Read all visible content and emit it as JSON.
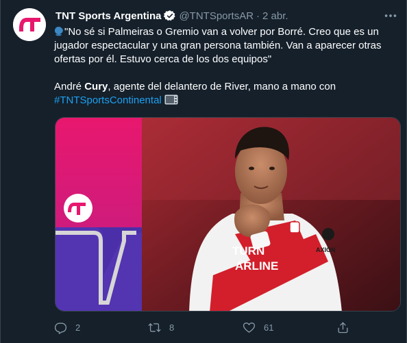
{
  "tweet": {
    "author_name": "TNT Sports Argentina",
    "handle": "@TNTSportsAR",
    "separator": "·",
    "date": "2 abr.",
    "quote_text": "\"No sé si Palmeiras o Gremio van a volver por Borré. Creo que es un jugador espectacular y una gran persona también. Van a aparecer otras ofertas por él. Estuvo cerca de los dos equipos\"",
    "second_paragraph_prefix": "André ",
    "second_paragraph_bold": "Cury",
    "second_paragraph_suffix": ", agente del delantero de River, mano a mano con",
    "hashtag": "#TNTSportsContinental",
    "media_player_shirt_text_1": "TURN",
    "media_player_shirt_text_2": "ARLINE",
    "media_player_sleeve_text": "AXION"
  },
  "actions": {
    "reply_count": "2",
    "retweet_count": "8",
    "like_count": "61"
  },
  "colors": {
    "background": "#15202b",
    "border": "#38444d",
    "muted_text": "#8899a6",
    "link": "#1da1f2",
    "brand_pink": "#e8176e",
    "brand_purple": "#4a2fa8"
  }
}
